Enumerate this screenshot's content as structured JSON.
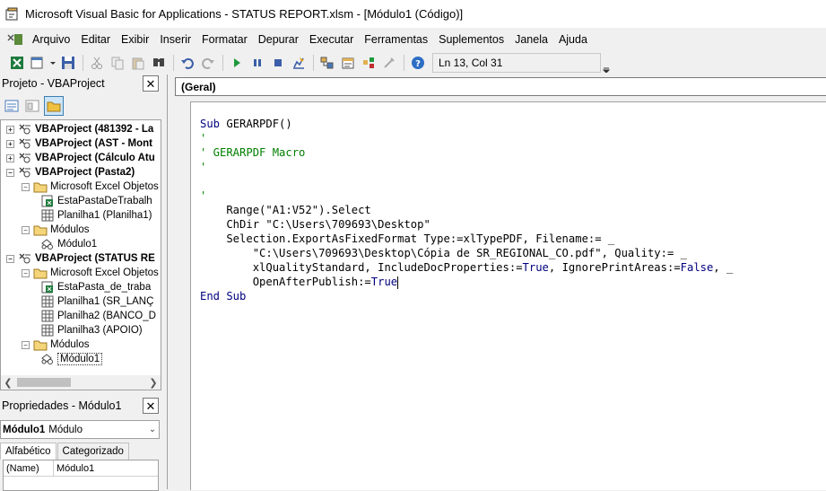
{
  "window": {
    "title": "Microsoft Visual Basic for Applications - STATUS REPORT.xlsm - [Módulo1 (Código)]"
  },
  "menu": [
    {
      "label": "Arquivo",
      "accel": "A",
      "rest": "rquivo"
    },
    {
      "label": "Editar",
      "accel": "E",
      "rest": "ditar"
    },
    {
      "label": "Exibir",
      "accel": "x",
      "pre": "E",
      "rest": "ibir"
    },
    {
      "label": "Inserir",
      "accel": "I",
      "rest": "nserir"
    },
    {
      "label": "Formatar",
      "accel": "o",
      "pre": "F",
      "rest": "rmatar"
    },
    {
      "label": "Depurar",
      "accel": "D",
      "rest": "epurar"
    },
    {
      "label": "Executar",
      "accel": "c",
      "pre": "Exe",
      "rest": "utar"
    },
    {
      "label": "Ferramentas",
      "accel": "F",
      "rest": "erramentas"
    },
    {
      "label": "Suplementos",
      "accel": "S",
      "rest": "uplementos"
    },
    {
      "label": "Janela",
      "accel": "J",
      "rest": "anela"
    },
    {
      "label": "Ajuda",
      "accel": "u",
      "pre": "Aj",
      "rest": "da"
    }
  ],
  "toolbar": {
    "position": "Ln 13, Col 31"
  },
  "project_panel": {
    "title": "Projeto - VBAProject",
    "tree": [
      {
        "label": "VBAProject (481392 - La",
        "bold": true,
        "expander": "+",
        "icon": "vbaproject-icon"
      },
      {
        "label": "VBAProject (AST - Mont",
        "bold": true,
        "expander": "+",
        "icon": "vbaproject-icon"
      },
      {
        "label": "VBAProject (Cálculo Atu",
        "bold": true,
        "expander": "+",
        "icon": "vbaproject-icon"
      },
      {
        "label": "VBAProject (Pasta2)",
        "bold": true,
        "expander": "−",
        "icon": "vbaproject-icon"
      },
      {
        "label": "Microsoft Excel Objetos",
        "bold": false,
        "expander": "−",
        "icon": "folder-icon"
      },
      {
        "label": "EstaPastaDeTrabalh",
        "bold": false,
        "expander": "",
        "icon": "workbook-icon"
      },
      {
        "label": "Planilha1 (Planilha1)",
        "bold": false,
        "expander": "",
        "icon": "worksheet-icon"
      },
      {
        "label": "Módulos",
        "bold": false,
        "expander": "−",
        "icon": "folder-icon"
      },
      {
        "label": "Módulo1",
        "bold": false,
        "expander": "",
        "icon": "module-icon"
      },
      {
        "label": "VBAProject (STATUS RE",
        "bold": true,
        "expander": "−",
        "icon": "vbaproject-icon"
      },
      {
        "label": "Microsoft Excel Objetos",
        "bold": false,
        "expander": "−",
        "icon": "folder-icon"
      },
      {
        "label": "EstaPasta_de_traba",
        "bold": false,
        "expander": "",
        "icon": "workbook-icon"
      },
      {
        "label": "Planilha1 (SR_LANÇ",
        "bold": false,
        "expander": "",
        "icon": "worksheet-icon"
      },
      {
        "label": "Planilha2 (BANCO_D",
        "bold": false,
        "expander": "",
        "icon": "worksheet-icon"
      },
      {
        "label": "Planilha3 (APOIO)",
        "bold": false,
        "expander": "",
        "icon": "worksheet-icon"
      },
      {
        "label": "Módulos",
        "bold": false,
        "expander": "−",
        "icon": "folder-icon"
      },
      {
        "label": "Módulo1",
        "bold": false,
        "expander": "",
        "icon": "module-icon",
        "selected": true
      }
    ]
  },
  "properties_panel": {
    "title": "Propriedades - Módulo1",
    "object_name": "Módulo1",
    "object_type": "Módulo",
    "tabs": [
      "Alfabético",
      "Categorizado"
    ],
    "rows": [
      {
        "key": "(Name)",
        "value": "Módulo1"
      }
    ]
  },
  "code_window": {
    "object_combo": "(Geral)",
    "lines": [
      [
        {
          "t": "Sub",
          "c": "kw"
        },
        {
          "t": " GERARPDF()",
          "c": ""
        }
      ],
      [
        {
          "t": "'",
          "c": "cm"
        }
      ],
      [
        {
          "t": "' GERARPDF Macro",
          "c": "cm"
        }
      ],
      [
        {
          "t": "'",
          "c": "cm"
        }
      ],
      [],
      [
        {
          "t": "'",
          "c": "cm"
        }
      ],
      [
        {
          "t": "    Range(\"A1:V52\").Select",
          "c": ""
        }
      ],
      [
        {
          "t": "    ChDir \"C:\\Users\\709693\\Desktop\"",
          "c": ""
        }
      ],
      [
        {
          "t": "    Selection.ExportAsFixedFormat Type:=xlTypePDF, Filename:= _",
          "c": ""
        }
      ],
      [
        {
          "t": "        \"C:\\Users\\709693\\Desktop\\Cópia de SR_REGIONAL_CO.pdf\", Quality:= _",
          "c": ""
        }
      ],
      [
        {
          "t": "        xlQualityStandard, IncludeDocProperties:=",
          "c": ""
        },
        {
          "t": "True",
          "c": "kw"
        },
        {
          "t": ", IgnorePrintAreas:=",
          "c": ""
        },
        {
          "t": "False",
          "c": "kw"
        },
        {
          "t": ", _",
          "c": ""
        }
      ],
      [
        {
          "t": "        OpenAfterPublish:=",
          "c": ""
        },
        {
          "t": "True",
          "c": "kw"
        }
      ],
      [
        {
          "t": "End Sub",
          "c": "kw"
        }
      ]
    ]
  }
}
